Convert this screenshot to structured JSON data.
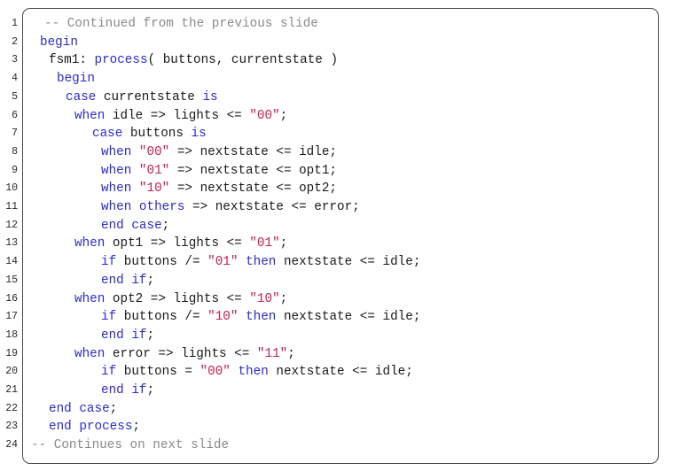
{
  "code": {
    "lines": [
      {
        "n": "1",
        "tokens": [
          {
            "t": "-- Continued from the previous slide",
            "k": "comment"
          }
        ]
      },
      {
        "n": "2",
        "tokens": [
          {
            "t": "begin",
            "k": "keyword"
          }
        ]
      },
      {
        "n": "3",
        "tokens": [
          {
            "t": "fsm1: ",
            "k": "plain"
          },
          {
            "t": "process",
            "k": "keyword"
          },
          {
            "t": "( buttons, currentstate )",
            "k": "plain"
          }
        ]
      },
      {
        "n": "4",
        "tokens": [
          {
            "t": "begin",
            "k": "keyword"
          }
        ]
      },
      {
        "n": "5",
        "tokens": [
          {
            "t": "case",
            "k": "keyword"
          },
          {
            "t": " currentstate ",
            "k": "plain"
          },
          {
            "t": "is",
            "k": "keyword"
          }
        ]
      },
      {
        "n": "6",
        "tokens": [
          {
            "t": "when",
            "k": "keyword"
          },
          {
            "t": " idle => lights <= ",
            "k": "plain"
          },
          {
            "t": "\"00\"",
            "k": "string"
          },
          {
            "t": ";",
            "k": "plain"
          }
        ]
      },
      {
        "n": "7",
        "tokens": [
          {
            "t": "case",
            "k": "keyword"
          },
          {
            "t": " buttons ",
            "k": "plain"
          },
          {
            "t": "is",
            "k": "keyword"
          }
        ]
      },
      {
        "n": "8",
        "tokens": [
          {
            "t": "when",
            "k": "keyword"
          },
          {
            "t": " ",
            "k": "plain"
          },
          {
            "t": "\"00\"",
            "k": "string"
          },
          {
            "t": " => nextstate <= idle;",
            "k": "plain"
          }
        ]
      },
      {
        "n": "9",
        "tokens": [
          {
            "t": "when",
            "k": "keyword"
          },
          {
            "t": " ",
            "k": "plain"
          },
          {
            "t": "\"01\"",
            "k": "string"
          },
          {
            "t": " => nextstate <= opt1;",
            "k": "plain"
          }
        ]
      },
      {
        "n": "10",
        "tokens": [
          {
            "t": "when",
            "k": "keyword"
          },
          {
            "t": " ",
            "k": "plain"
          },
          {
            "t": "\"10\"",
            "k": "string"
          },
          {
            "t": " => nextstate <= opt2;",
            "k": "plain"
          }
        ]
      },
      {
        "n": "11",
        "tokens": [
          {
            "t": "when",
            "k": "keyword"
          },
          {
            "t": " ",
            "k": "plain"
          },
          {
            "t": "others",
            "k": "keyword"
          },
          {
            "t": " => nextstate <= error;",
            "k": "plain"
          }
        ]
      },
      {
        "n": "12",
        "tokens": [
          {
            "t": "end",
            "k": "keyword"
          },
          {
            "t": " ",
            "k": "plain"
          },
          {
            "t": "case",
            "k": "keyword"
          },
          {
            "t": ";",
            "k": "plain"
          }
        ]
      },
      {
        "n": "13",
        "tokens": [
          {
            "t": "when",
            "k": "keyword"
          },
          {
            "t": " opt1 => lights <= ",
            "k": "plain"
          },
          {
            "t": "\"01\"",
            "k": "string"
          },
          {
            "t": ";",
            "k": "plain"
          }
        ]
      },
      {
        "n": "14",
        "tokens": [
          {
            "t": "if",
            "k": "keyword"
          },
          {
            "t": " buttons /= ",
            "k": "plain"
          },
          {
            "t": "\"01\"",
            "k": "string"
          },
          {
            "t": " ",
            "k": "plain"
          },
          {
            "t": "then",
            "k": "keyword"
          },
          {
            "t": " nextstate <= idle;",
            "k": "plain"
          }
        ]
      },
      {
        "n": "15",
        "tokens": [
          {
            "t": "end",
            "k": "keyword"
          },
          {
            "t": " ",
            "k": "plain"
          },
          {
            "t": "if",
            "k": "keyword"
          },
          {
            "t": ";",
            "k": "plain"
          }
        ]
      },
      {
        "n": "16",
        "tokens": [
          {
            "t": "when",
            "k": "keyword"
          },
          {
            "t": " opt2 => lights <= ",
            "k": "plain"
          },
          {
            "t": "\"10\"",
            "k": "string"
          },
          {
            "t": ";",
            "k": "plain"
          }
        ]
      },
      {
        "n": "17",
        "tokens": [
          {
            "t": "if",
            "k": "keyword"
          },
          {
            "t": " buttons /= ",
            "k": "plain"
          },
          {
            "t": "\"10\"",
            "k": "string"
          },
          {
            "t": " ",
            "k": "plain"
          },
          {
            "t": "then",
            "k": "keyword"
          },
          {
            "t": " nextstate <= idle;",
            "k": "plain"
          }
        ]
      },
      {
        "n": "18",
        "tokens": [
          {
            "t": "end",
            "k": "keyword"
          },
          {
            "t": " ",
            "k": "plain"
          },
          {
            "t": "if",
            "k": "keyword"
          },
          {
            "t": ";",
            "k": "plain"
          }
        ]
      },
      {
        "n": "19",
        "tokens": [
          {
            "t": "when",
            "k": "keyword"
          },
          {
            "t": " error => lights <= ",
            "k": "plain"
          },
          {
            "t": "\"11\"",
            "k": "string"
          },
          {
            "t": ";",
            "k": "plain"
          }
        ]
      },
      {
        "n": "20",
        "tokens": [
          {
            "t": "if",
            "k": "keyword"
          },
          {
            "t": " buttons = ",
            "k": "plain"
          },
          {
            "t": "\"00\"",
            "k": "string"
          },
          {
            "t": " ",
            "k": "plain"
          },
          {
            "t": "then",
            "k": "keyword"
          },
          {
            "t": " nextstate <= idle;",
            "k": "plain"
          }
        ]
      },
      {
        "n": "21",
        "tokens": [
          {
            "t": "end",
            "k": "keyword"
          },
          {
            "t": " ",
            "k": "plain"
          },
          {
            "t": "if",
            "k": "keyword"
          },
          {
            "t": ";",
            "k": "plain"
          }
        ]
      },
      {
        "n": "22",
        "tokens": [
          {
            "t": "end",
            "k": "keyword"
          },
          {
            "t": " ",
            "k": "plain"
          },
          {
            "t": "case",
            "k": "keyword"
          },
          {
            "t": ";",
            "k": "plain"
          }
        ]
      },
      {
        "n": "23",
        "tokens": [
          {
            "t": "end",
            "k": "keyword"
          },
          {
            "t": " ",
            "k": "plain"
          },
          {
            "t": "process",
            "k": "keyword"
          },
          {
            "t": ";",
            "k": "plain"
          }
        ]
      },
      {
        "n": "24",
        "tokens": [
          {
            "t": "-- Continues on next slide",
            "k": "comment"
          }
        ]
      }
    ]
  },
  "colors": {
    "keyword": "#2b2bd1",
    "string": "#c8204a",
    "comment": "#8a8a8a",
    "plain": "#1a1a1a",
    "frame": "#4a4a4a"
  }
}
